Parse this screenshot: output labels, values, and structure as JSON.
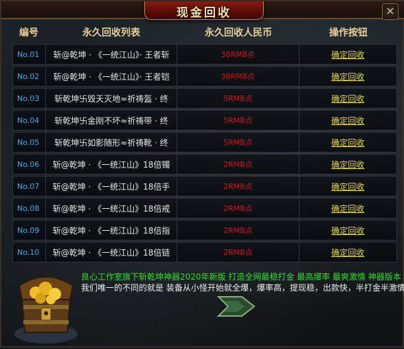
{
  "window": {
    "title": "现金回收",
    "close_glyph": "×"
  },
  "columns": [
    "编号",
    "永久回收列表",
    "永久回收人民币",
    "操作按钮"
  ],
  "rows": [
    {
      "no": "No.01",
      "item": "斩@乾坤 · 《一统江山》· 王者斩",
      "price": "38RMB点",
      "action": "确定回收"
    },
    {
      "no": "No.02",
      "item": "斩@乾坤 · 《一统江山》· 王者铠",
      "price": "38RMB点",
      "action": "确定回收"
    },
    {
      "no": "No.03",
      "item": "斩乾坤卐毁天灭地≈祈祷盔 · 终",
      "price": "5RMB点",
      "action": "确定回收"
    },
    {
      "no": "No.04",
      "item": "斩乾坤卐金刚不坏≈祈祷带 · 终",
      "price": "5RMB点",
      "action": "确定回收"
    },
    {
      "no": "No.05",
      "item": "斩乾坤卐如影随形≈祈祷靴 · 终",
      "price": "5RMB点",
      "action": "确定回收"
    },
    {
      "no": "No.06",
      "item": "斩@乾坤 · 《一统江山》18倍镯",
      "price": "2RMB点",
      "action": "确定回收"
    },
    {
      "no": "No.07",
      "item": "斩@乾坤 · 《一统江山》18倍手",
      "price": "2RMB点",
      "action": "确定回收"
    },
    {
      "no": "No.08",
      "item": "斩@乾坤 · 《一统江山》18倍戒",
      "price": "2RMB点",
      "action": "确定回收"
    },
    {
      "no": "No.09",
      "item": "斩@乾坤 · 《一统江山》18倍指",
      "price": "2RMB点",
      "action": "确定回收"
    },
    {
      "no": "No.10",
      "item": "斩@乾坤 · 《一统江山》18倍链",
      "price": "2RMB点",
      "action": "确定回收"
    }
  ],
  "footer": {
    "line1": "良心工作室旗下斩乾坤神器2020年新版 打造全网最稳打金 最高爆率 最爽激情 神器版本",
    "line2": "我们唯一的不同的就是 装备从小怪开始就全爆，爆率高，提现稳，出款快，半打金半激情"
  },
  "colors": {
    "no": "#4aa8e8",
    "price": "#d01818",
    "action": "#f0d848",
    "header": "#e6cf98",
    "green_text": "#30e030"
  },
  "icons": {
    "chest": "treasure-chest-icon",
    "next": "chevron-right-icon"
  }
}
